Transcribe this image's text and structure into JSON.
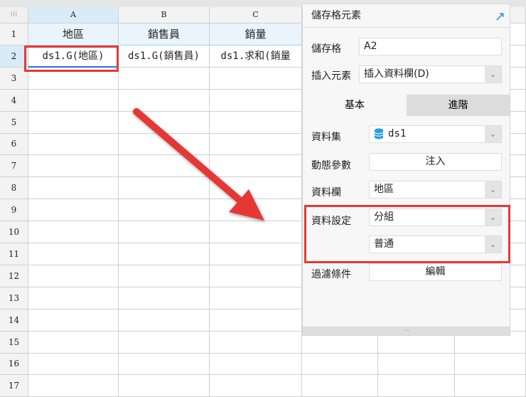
{
  "sheet": {
    "columns": [
      "A",
      "B",
      "C"
    ],
    "rows": [
      "1",
      "2",
      "3",
      "4",
      "5",
      "6",
      "7",
      "8",
      "9",
      "10",
      "11",
      "12",
      "13",
      "14",
      "15",
      "16",
      "17"
    ],
    "header_cells": [
      "地區",
      "銷售員",
      "銷量"
    ],
    "data_cells": [
      "ds1.G(地區)",
      "ds1.G(銷售員)",
      "ds1.求和(銷量"
    ]
  },
  "panel": {
    "title": "儲存格元素",
    "cell_label": "儲存格",
    "cell_value": "A2",
    "insert_label": "插入元素",
    "insert_value": "插入資料欄(D)",
    "tabs": [
      "基本",
      "進階"
    ],
    "dataset_label": "資料集",
    "dataset_value": "ds1",
    "param_label": "動態參數",
    "param_button": "注入",
    "column_label": "資料欄",
    "column_value": "地區",
    "setting_label": "資料設定",
    "setting_value1": "分組",
    "setting_value2": "普通",
    "filter_label": "過濾條件",
    "filter_button": "編輯",
    "footer_handle": "..."
  },
  "colors": {
    "accent": "#2a88d8",
    "highlight": "#e53935"
  }
}
